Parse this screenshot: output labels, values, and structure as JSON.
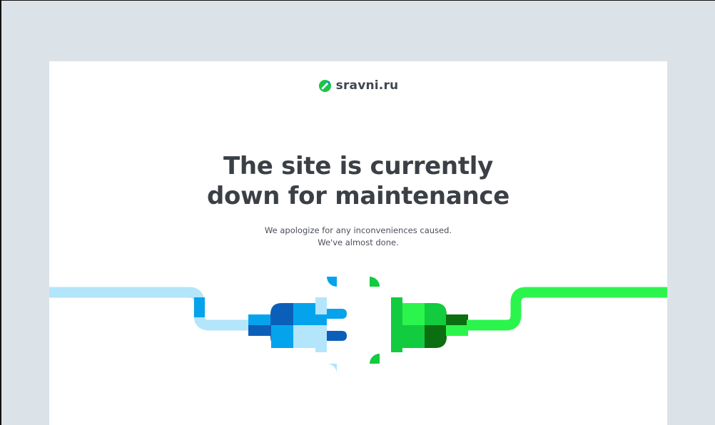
{
  "brand": {
    "name": "sravni.ru",
    "icon": "sravni-logo-icon",
    "icon_color": "#1fc24a",
    "icon_accent": "#1a8fe0"
  },
  "message": {
    "title_line1": "The site is currently",
    "title_line2": "down for maintenance",
    "body_line1": "We apologize for any inconveniences caused.",
    "body_line2": "We've almost done."
  },
  "illustration": {
    "name": "unplugged-cable-illustration",
    "colors": {
      "blue_light": "#b3e5fb",
      "blue": "#05a3ec",
      "blue_dark": "#0b5fb8",
      "green_bright": "#2bf54c",
      "green": "#12cb3f",
      "green_dark": "#0b6e10"
    }
  },
  "colors": {
    "page_background": "#dce3e8",
    "card_background": "#ffffff",
    "title_text": "#3b3f46"
  }
}
